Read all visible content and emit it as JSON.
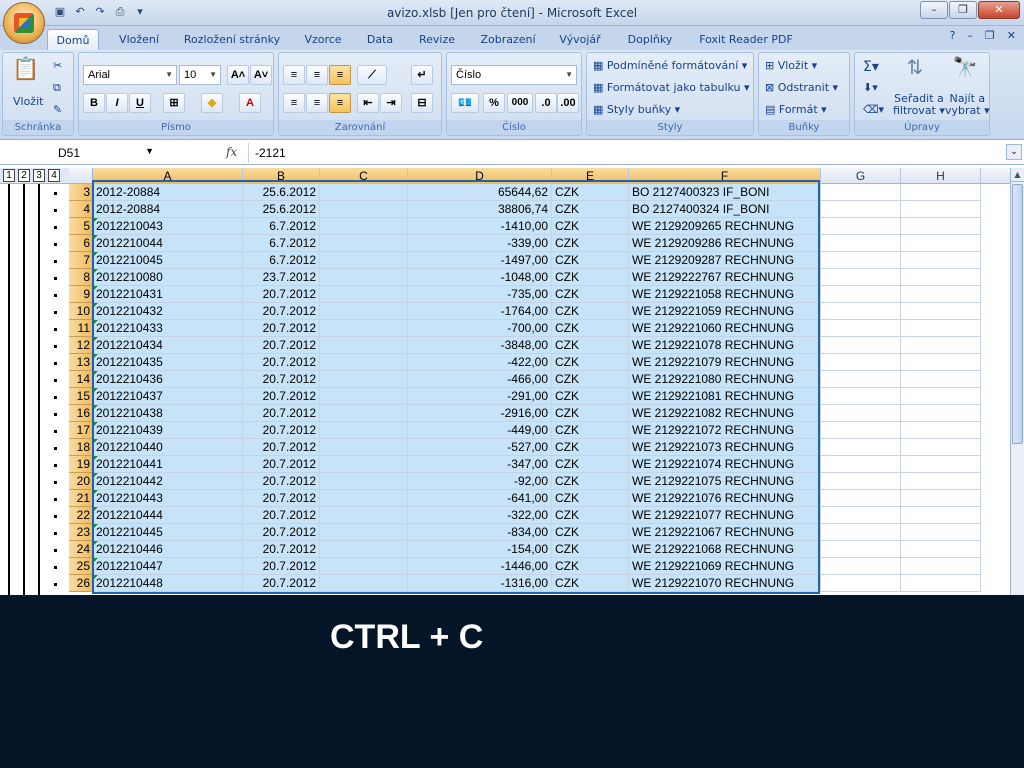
{
  "window": {
    "title": "avizo.xlsb  [Jen pro čtení] - Microsoft Excel"
  },
  "ribbon_tabs": [
    "Domů",
    "Vložení",
    "Rozložení stránky",
    "Vzorce",
    "Data",
    "Revize",
    "Zobrazení",
    "Vývojář",
    "Doplňky",
    "Foxit Reader PDF"
  ],
  "groups": {
    "clipboard": {
      "label": "Schránka",
      "paste": "Vložit"
    },
    "font": {
      "label": "Písmo",
      "family": "Arial",
      "size": "10"
    },
    "alignment": {
      "label": "Zarovnání"
    },
    "number": {
      "label": "Číslo",
      "format": "Číslo"
    },
    "styles": {
      "label": "Styly",
      "cond_format": "Podmíněné formátování",
      "format_table": "Formátovat jako tabulku",
      "cell_styles": "Styly buňky"
    },
    "cells": {
      "label": "Buňky",
      "insert": "Vložit",
      "delete": "Odstranit",
      "format": "Formát"
    },
    "editing": {
      "label": "Úpravy",
      "sort1": "Seřadit a",
      "sort2": "filtrovat",
      "find1": "Najít a",
      "find2": "vybrat"
    }
  },
  "formula_bar": {
    "name_box": "D51",
    "fx": "fx",
    "value": "-2121"
  },
  "outline_levels": [
    "1",
    "2",
    "3",
    "4"
  ],
  "columns": [
    "A",
    "B",
    "C",
    "D",
    "E",
    "F",
    "G",
    "H"
  ],
  "rows": [
    {
      "n": "3",
      "a": "2012-20884",
      "b": "25.6.2012",
      "d": "65644,62",
      "e": "CZK",
      "f": "BO   2127400323 IF_BONI"
    },
    {
      "n": "4",
      "a": "2012-20884",
      "b": "25.6.2012",
      "d": "38806,74",
      "e": "CZK",
      "f": "BO   2127400324 IF_BONI"
    },
    {
      "n": "5",
      "a": "2012210043",
      "b": "6.7.2012",
      "d": "-1410,00",
      "e": "CZK",
      "f": "WE   2129209265 RECHNUNG"
    },
    {
      "n": "6",
      "a": "2012210044",
      "b": "6.7.2012",
      "d": "-339,00",
      "e": "CZK",
      "f": "WE   2129209286 RECHNUNG"
    },
    {
      "n": "7",
      "a": "2012210045",
      "b": "6.7.2012",
      "d": "-1497,00",
      "e": "CZK",
      "f": "WE   2129209287 RECHNUNG"
    },
    {
      "n": "8",
      "a": "2012210080",
      "b": "23.7.2012",
      "d": "-1048,00",
      "e": "CZK",
      "f": "WE   2129222767 RECHNUNG"
    },
    {
      "n": "9",
      "a": "2012210431",
      "b": "20.7.2012",
      "d": "-735,00",
      "e": "CZK",
      "f": "WE   2129221058 RECHNUNG"
    },
    {
      "n": "10",
      "a": "2012210432",
      "b": "20.7.2012",
      "d": "-1764,00",
      "e": "CZK",
      "f": "WE   2129221059 RECHNUNG"
    },
    {
      "n": "11",
      "a": "2012210433",
      "b": "20.7.2012",
      "d": "-700,00",
      "e": "CZK",
      "f": "WE   2129221060 RECHNUNG"
    },
    {
      "n": "12",
      "a": "2012210434",
      "b": "20.7.2012",
      "d": "-3848,00",
      "e": "CZK",
      "f": "WE   2129221078 RECHNUNG"
    },
    {
      "n": "13",
      "a": "2012210435",
      "b": "20.7.2012",
      "d": "-422,00",
      "e": "CZK",
      "f": "WE   2129221079 RECHNUNG"
    },
    {
      "n": "14",
      "a": "2012210436",
      "b": "20.7.2012",
      "d": "-466,00",
      "e": "CZK",
      "f": "WE   2129221080 RECHNUNG"
    },
    {
      "n": "15",
      "a": "2012210437",
      "b": "20.7.2012",
      "d": "-291,00",
      "e": "CZK",
      "f": "WE   2129221081 RECHNUNG"
    },
    {
      "n": "16",
      "a": "2012210438",
      "b": "20.7.2012",
      "d": "-2916,00",
      "e": "CZK",
      "f": "WE   2129221082 RECHNUNG"
    },
    {
      "n": "17",
      "a": "2012210439",
      "b": "20.7.2012",
      "d": "-449,00",
      "e": "CZK",
      "f": "WE   2129221072 RECHNUNG"
    },
    {
      "n": "18",
      "a": "2012210440",
      "b": "20.7.2012",
      "d": "-527,00",
      "e": "CZK",
      "f": "WE   2129221073 RECHNUNG"
    },
    {
      "n": "19",
      "a": "2012210441",
      "b": "20.7.2012",
      "d": "-347,00",
      "e": "CZK",
      "f": "WE   2129221074 RECHNUNG"
    },
    {
      "n": "20",
      "a": "2012210442",
      "b": "20.7.2012",
      "d": "-92,00",
      "e": "CZK",
      "f": "WE   2129221075 RECHNUNG"
    },
    {
      "n": "21",
      "a": "2012210443",
      "b": "20.7.2012",
      "d": "-641,00",
      "e": "CZK",
      "f": "WE   2129221076 RECHNUNG"
    },
    {
      "n": "22",
      "a": "2012210444",
      "b": "20.7.2012",
      "d": "-322,00",
      "e": "CZK",
      "f": "WE   2129221077 RECHNUNG"
    },
    {
      "n": "23",
      "a": "2012210445",
      "b": "20.7.2012",
      "d": "-834,00",
      "e": "CZK",
      "f": "WE   2129221067 RECHNUNG"
    },
    {
      "n": "24",
      "a": "2012210446",
      "b": "20.7.2012",
      "d": "-154,00",
      "e": "CZK",
      "f": "WE   2129221068 RECHNUNG"
    },
    {
      "n": "25",
      "a": "2012210447",
      "b": "20.7.2012",
      "d": "-1446,00",
      "e": "CZK",
      "f": "WE   2129221069 RECHNUNG"
    },
    {
      "n": "26",
      "a": "2012210448",
      "b": "20.7.2012",
      "d": "-1316,00",
      "e": "CZK",
      "f": "WE   2129221070 RECHNUNG"
    }
  ],
  "caption": "CTRL + C",
  "colors": {
    "selection": "#c6e3f8",
    "selection_border": "#1e62b4",
    "background": "#061428"
  }
}
